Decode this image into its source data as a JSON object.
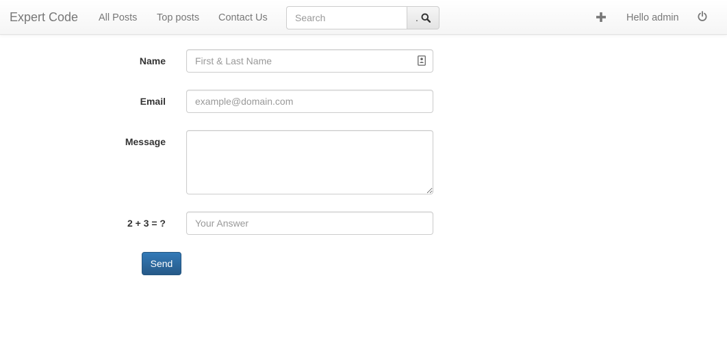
{
  "navbar": {
    "brand": "Expert Code",
    "links": [
      {
        "label": "All Posts"
      },
      {
        "label": "Top posts"
      },
      {
        "label": "Contact Us"
      }
    ],
    "search": {
      "placeholder": "Search",
      "button_text": ".",
      "button_icon": "search-icon"
    },
    "add_icon": "plus-icon",
    "greeting": "Hello admin",
    "logout_icon": "power-icon"
  },
  "contact_form": {
    "name": {
      "label": "Name",
      "placeholder": "First & Last Name",
      "value": "",
      "icon": "contact-card-icon"
    },
    "email": {
      "label": "Email",
      "placeholder": "example@domain.com",
      "value": ""
    },
    "message": {
      "label": "Message",
      "value": ""
    },
    "captcha": {
      "label": "2 + 3 = ?",
      "placeholder": "Your Answer",
      "value": ""
    },
    "submit_label": "Send"
  },
  "colors": {
    "primary_button": "#337ab7",
    "navbar_text": "#777777"
  }
}
